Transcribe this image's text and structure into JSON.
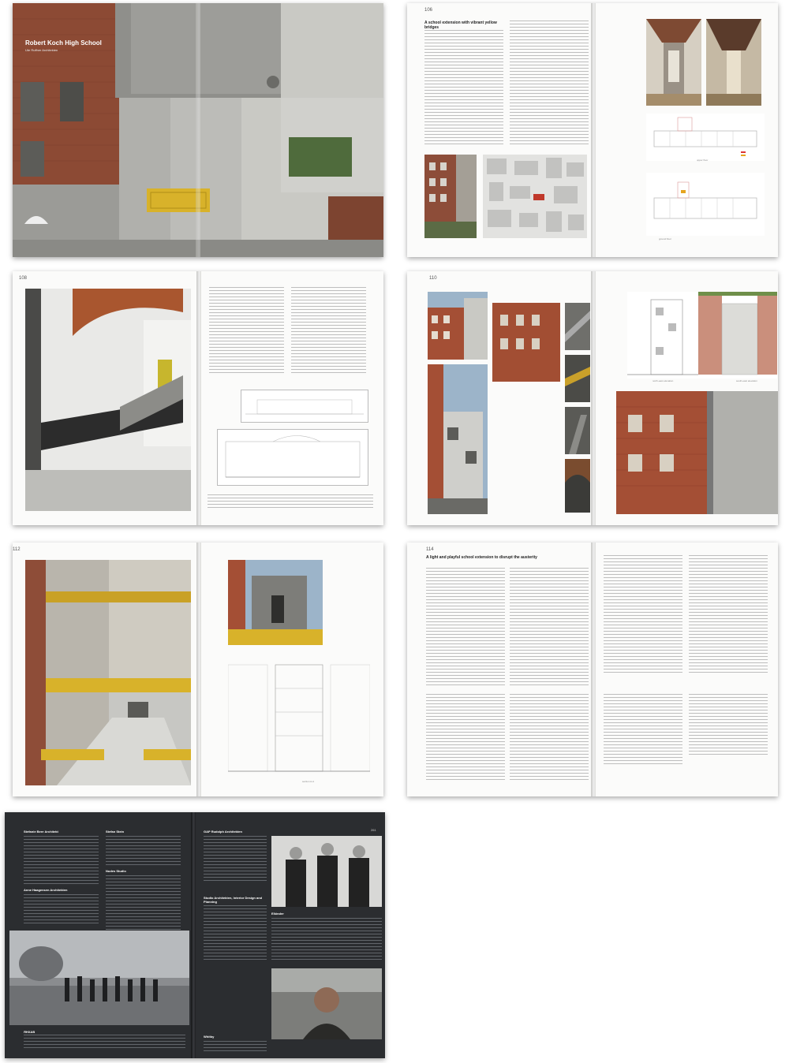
{
  "spread1": {
    "cover_title": "Robert Koch High School",
    "cover_subtitle": "Ute Ruffner Architekten"
  },
  "spread2": {
    "page_number": "106",
    "heading": "A school extension with vibrant yellow bridges",
    "plan_label_1": "upper floor",
    "plan_label_2": "ground floor"
  },
  "spread3": {
    "page_number": "108"
  },
  "spread4": {
    "page_number": "110",
    "elev_label_1": "north-east elevation",
    "elev_label_2": "south-east elevation"
  },
  "spread5": {
    "page_number": "112",
    "section_label": "section A-A"
  },
  "spread6": {
    "page_number": "114",
    "heading": "A light and playful school extension to disrupt the austerity"
  },
  "spread7": {
    "page_number": "261",
    "names": [
      "Stefanie Beer Architekt",
      "Anne Haagensen Architekten",
      "Stefan Stein",
      "Nudes Studio",
      "GAP Rudolph Architekten",
      "Studio Architekten, Interior Design and Planning",
      "Elkinder",
      "Whitby",
      "ЯНХАВ"
    ]
  },
  "colors": {
    "accent_yellow": "#d8b22a",
    "brick": "#8c4a34",
    "concrete": "#a8a8a4",
    "dark_page": "#2b2d30"
  }
}
